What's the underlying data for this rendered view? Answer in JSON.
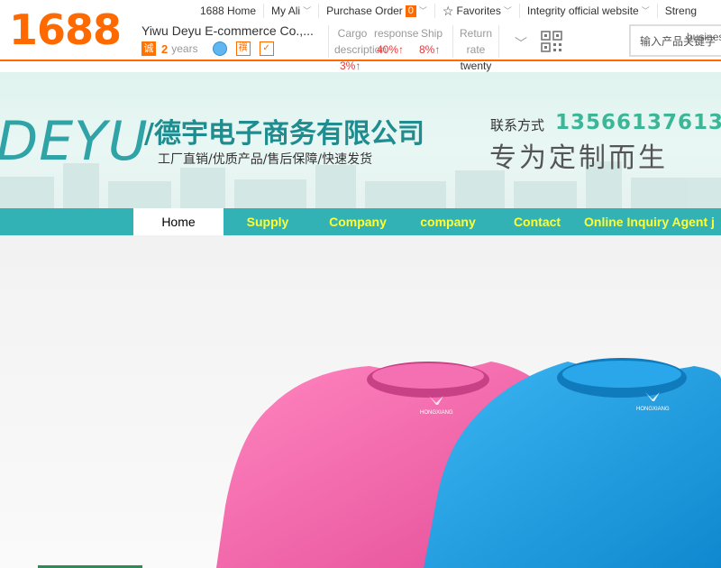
{
  "header": {
    "logo": "1688",
    "company_name": "Yiwu Deyu E-commerce Co.,...",
    "cheng_badge": "诚",
    "years_num": "2",
    "years_label": "years",
    "square_badge": "襈"
  },
  "topnav": {
    "home": "1688 Home",
    "my_ali": "My Ali",
    "purchase_order": "Purchase Order",
    "purchase_count": "0",
    "favorites": "Favorites",
    "integrity": "Integrity official website",
    "streng": "Streng"
  },
  "stats": {
    "cargo_label": "Cargo description",
    "cargo_value": "3%↑",
    "response_label": "response",
    "response_value": "40%↑",
    "ship_label": "Ship",
    "ship_value": "8%↑",
    "return_label": "Return rate",
    "return_value": "twenty four%"
  },
  "search": {
    "placeholder": "输入产品关键字",
    "business": "busines"
  },
  "banner": {
    "brand": "DEYU",
    "slash": "/",
    "company_cn": "德宇电子商务有限公司",
    "tagline": "工厂直销/优质产品/售后保障/快速发货",
    "contact_label": "联系方式",
    "phone": "13566137613",
    "slogan": "专为定制而生"
  },
  "mainnav": {
    "tabs": [
      "Home",
      "Supply",
      "Company",
      "company",
      "Contact",
      "Online Inquiry Agent j"
    ]
  },
  "hero": {
    "shirt_brand": "HONGXIANG",
    "colors": {
      "pink": "#f262a8",
      "blue": "#1b9ee3"
    }
  }
}
